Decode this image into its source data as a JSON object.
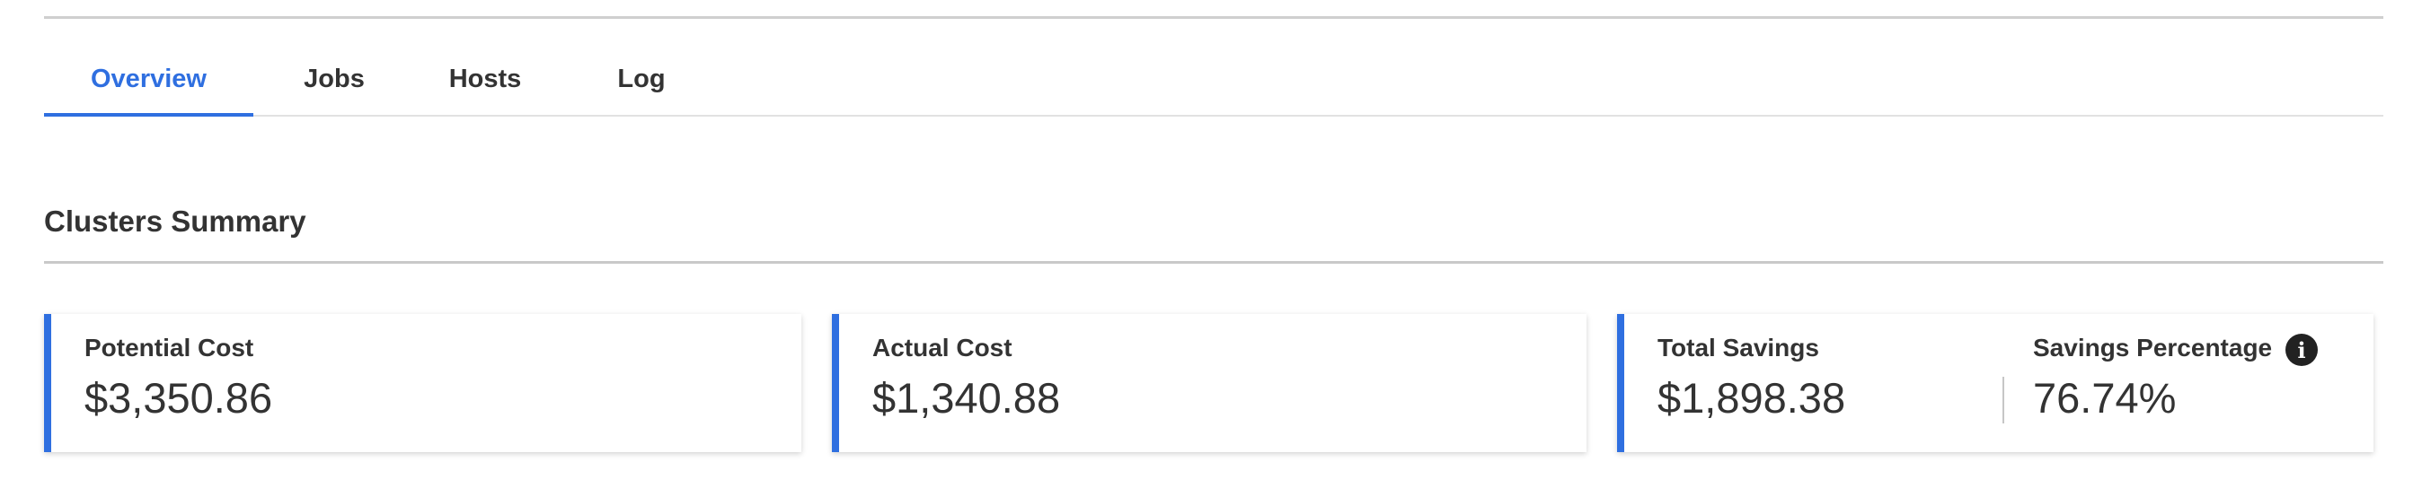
{
  "tabs": [
    {
      "label": "Overview",
      "active": true
    },
    {
      "label": "Jobs",
      "active": false
    },
    {
      "label": "Hosts",
      "active": false
    },
    {
      "label": "Log",
      "active": false
    }
  ],
  "summary": {
    "title": "Clusters Summary",
    "cards": [
      {
        "label": "Potential Cost",
        "value": "$3,350.86"
      },
      {
        "label": "Actual Cost",
        "value": "$1,340.88"
      },
      {
        "metrics": [
          {
            "label": "Total Savings",
            "value": "$1,898.38"
          },
          {
            "label": "Savings Percentage",
            "value": "76.74%",
            "icon": "info-icon"
          }
        ]
      }
    ]
  },
  "colors": {
    "accent": "#2f6fe0",
    "text": "#333333",
    "rule": "#cfcfcf"
  },
  "icons": {
    "info": "i"
  }
}
